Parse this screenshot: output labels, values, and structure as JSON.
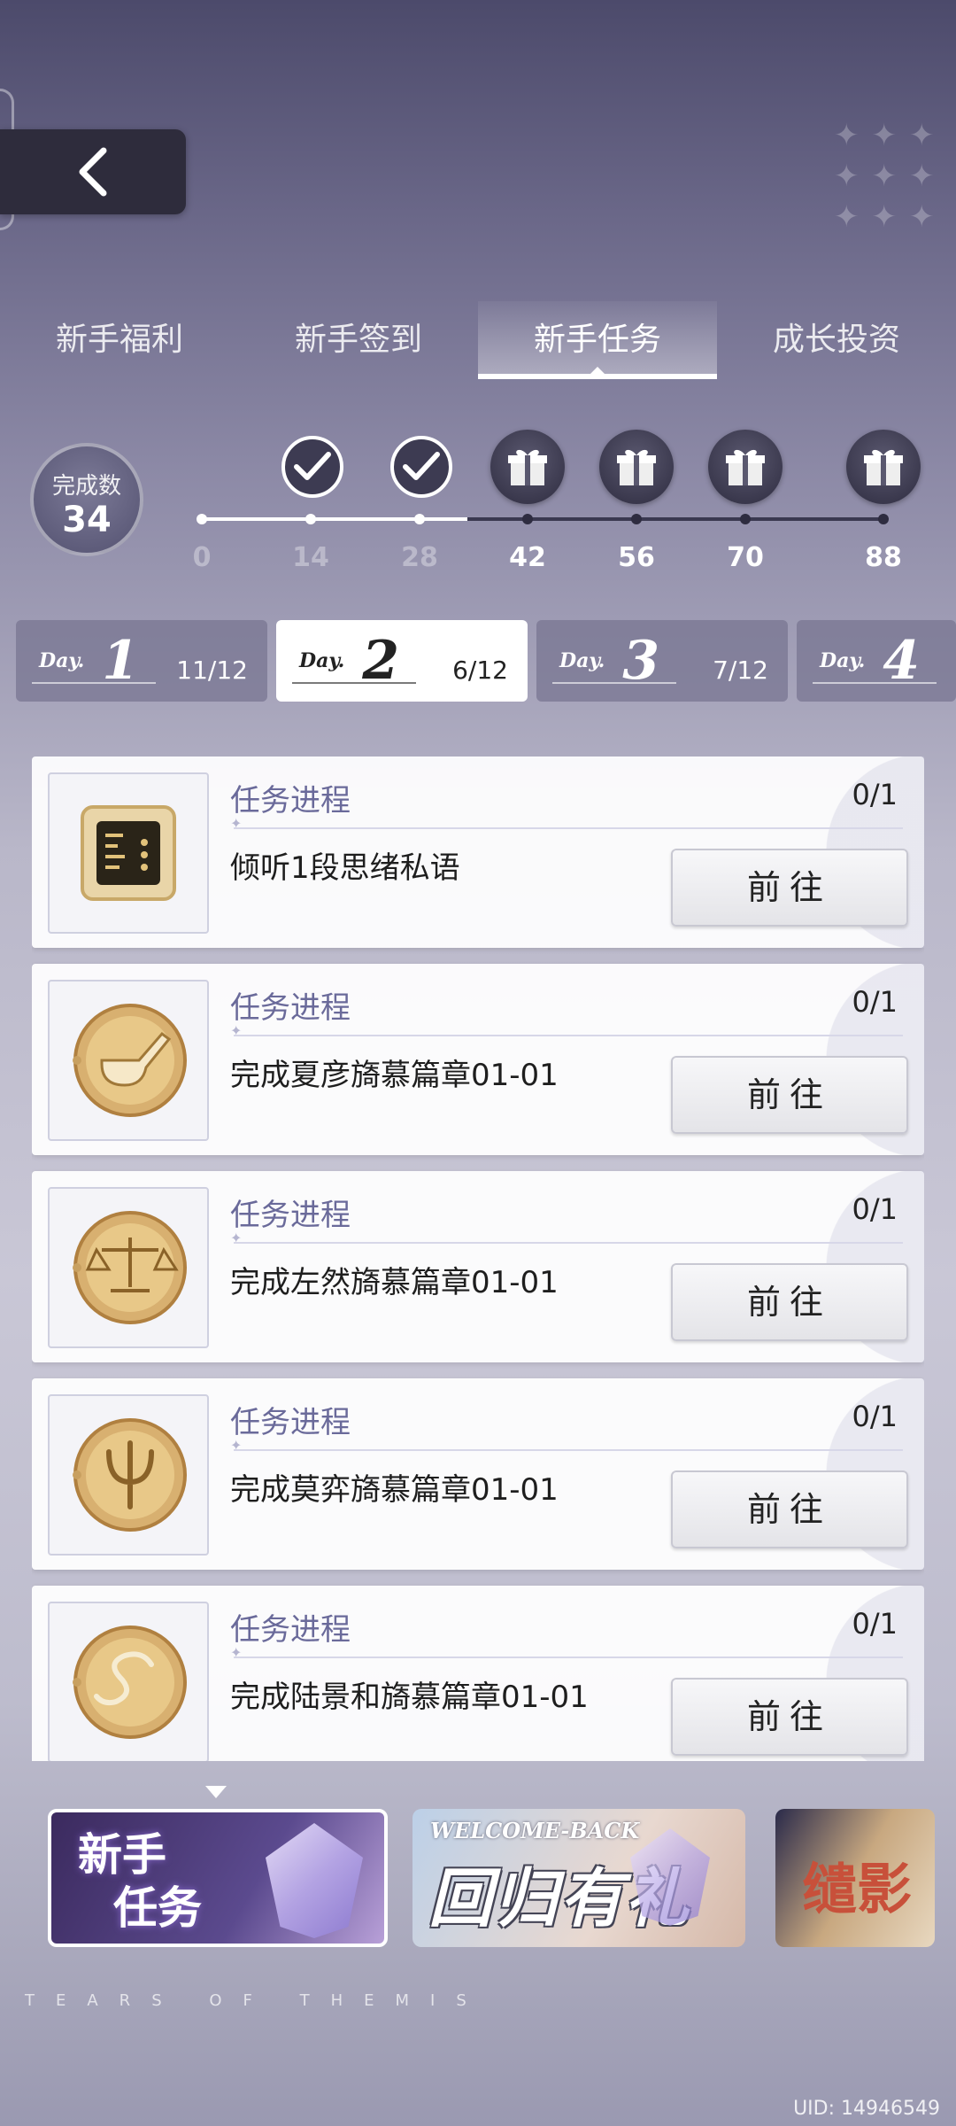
{
  "header": {
    "back_icon": "chevron-left-icon"
  },
  "tabs": [
    {
      "label": "新手福利",
      "active": false
    },
    {
      "label": "新手签到",
      "active": false
    },
    {
      "label": "新手任务",
      "active": true
    },
    {
      "label": "成长投资",
      "active": false
    }
  ],
  "progress": {
    "count_label": "完成数",
    "count_value": "34",
    "milestones": [
      {
        "value": "0",
        "state": "done"
      },
      {
        "value": "14",
        "state": "claimed"
      },
      {
        "value": "28",
        "state": "claimed"
      },
      {
        "value": "42",
        "state": "gift"
      },
      {
        "value": "56",
        "state": "gift"
      },
      {
        "value": "70",
        "state": "gift"
      },
      {
        "value": "88",
        "state": "gift"
      }
    ]
  },
  "days": [
    {
      "prefix": "Day.",
      "num": "1",
      "count": "11/12",
      "active": false
    },
    {
      "prefix": "Day.",
      "num": "2",
      "count": "6/12",
      "active": true
    },
    {
      "prefix": "Day.",
      "num": "3",
      "count": "7/12",
      "active": false
    },
    {
      "prefix": "Day.",
      "num": "4",
      "count": "",
      "active": false
    }
  ],
  "tasks": [
    {
      "title": "任务进程",
      "progress": "0/1",
      "desc": "倾听1段思绪私语",
      "button": "前往",
      "icon": "chip-icon"
    },
    {
      "title": "任务进程",
      "progress": "0/1",
      "desc": "完成夏彦旖慕篇章01-01",
      "button": "前往",
      "icon": "pipe-coin-icon"
    },
    {
      "title": "任务进程",
      "progress": "0/1",
      "desc": "完成左然旖慕篇章01-01",
      "button": "前往",
      "icon": "scales-coin-icon"
    },
    {
      "title": "任务进程",
      "progress": "0/1",
      "desc": "完成莫弈旖慕篇章01-01",
      "button": "前往",
      "icon": "psi-coin-icon"
    },
    {
      "title": "任务进程",
      "progress": "0/1",
      "desc": "完成陆景和旖慕篇章01-01",
      "button": "前往",
      "icon": "serpent-coin-icon"
    }
  ],
  "banners": [
    {
      "line1": "新手",
      "line2": "任务"
    },
    {
      "sub": "WELCOME-BACK",
      "title": "回归有礼"
    },
    {
      "title": "缱影"
    }
  ],
  "footer": {
    "brand": "TEARS OF THEMIS",
    "uid": "UID: 14946549"
  },
  "colors": {
    "accent": "#6a6a9a",
    "tab_active": "#ffffff",
    "card_bg": "#ffffff"
  }
}
